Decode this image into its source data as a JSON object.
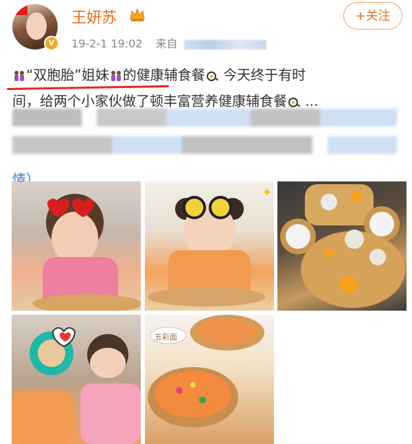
{
  "user": {
    "name": "王妍苏",
    "timestamp": "19-2-1 19:02",
    "source_prefix": "来自",
    "avatar_icon": "avatar-photo",
    "verified_icon": "verified-v-icon"
  },
  "follow_button": {
    "label": "+关注"
  },
  "post": {
    "line1_quote_open": "“",
    "line1_twins": "双胞胎",
    "line1_quote_close": "”",
    "line1_sisters": "姐妹",
    "line1_rest": "的健康辅食餐",
    "line1_tail": " 今天终于有时",
    "line2": "间，给两个小家伙做了顿丰富营养健康辅食餐",
    "line2_ellipsis": " ...",
    "last_line": "情）"
  },
  "gallery": {
    "caption_tile5": "五彩面"
  },
  "colors": {
    "name": "#e86b1b",
    "follow_border": "#f2a25c",
    "underline": "#e22222"
  }
}
